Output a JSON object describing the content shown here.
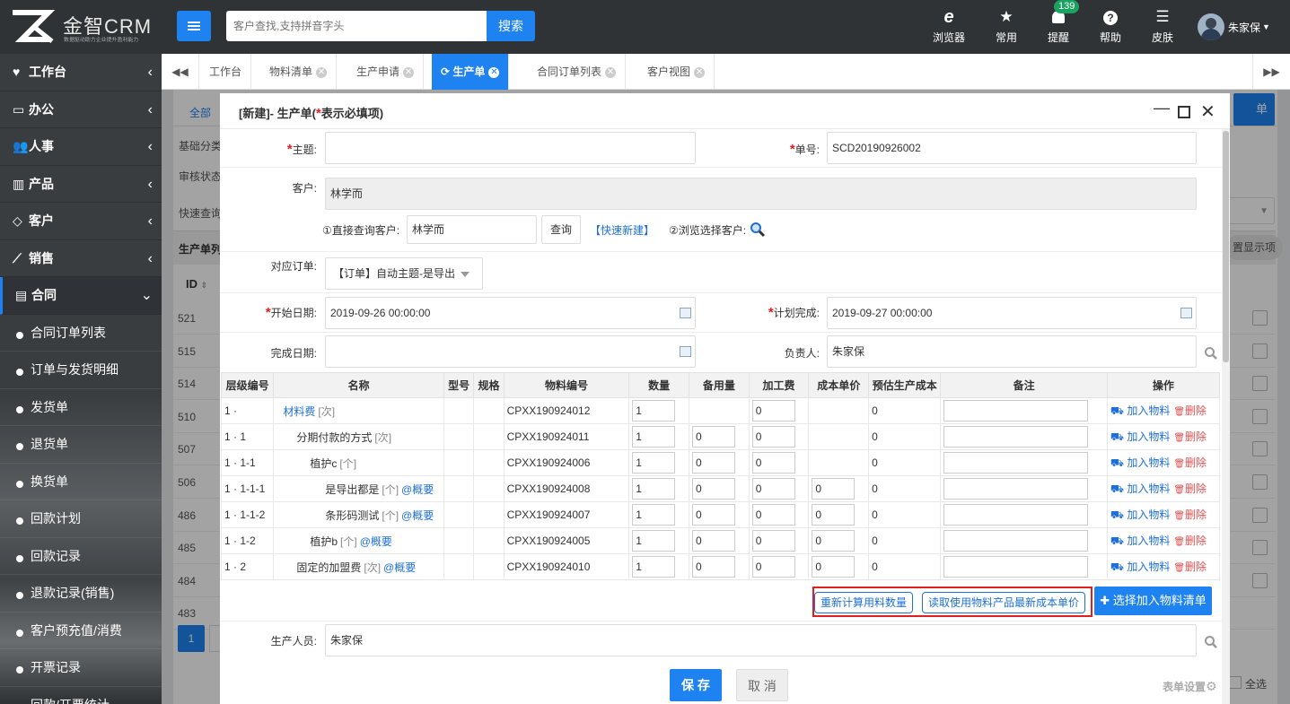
{
  "app": {
    "brand": "金智CRM",
    "slogan": "数据驱动助力企业提升盈利能力"
  },
  "header": {
    "search_placeholder": "客户查找,支持拼音字头",
    "search_button": "搜索",
    "tools": [
      {
        "label": "浏览器",
        "icon": "ie-icon"
      },
      {
        "label": "常用",
        "icon": "star-icon"
      },
      {
        "label": "提醒",
        "icon": "bell-icon",
        "badge": "139"
      },
      {
        "label": "帮助",
        "icon": "help-icon"
      },
      {
        "label": "皮肤",
        "icon": "skin-icon"
      }
    ],
    "user": "朱家保"
  },
  "sidebar": {
    "items": [
      {
        "label": "工作台",
        "icon": "heart-icon"
      },
      {
        "label": "办公",
        "icon": "laptop-icon"
      },
      {
        "label": "人事",
        "icon": "users-icon"
      },
      {
        "label": "产品",
        "icon": "barcode-icon"
      },
      {
        "label": "客户",
        "icon": "diamond-icon"
      },
      {
        "label": "销售",
        "icon": "chart-icon"
      },
      {
        "label": "合同",
        "icon": "contract-icon"
      }
    ],
    "sub_items": [
      "合同订单列表",
      "订单与发货明细",
      "发货单",
      "退货单",
      "换货单",
      "回款计划",
      "回款记录",
      "退款记录(销售)",
      "客户预充值/消费",
      "开票记录",
      "回款/开票统计"
    ]
  },
  "tabs": [
    {
      "label": "工作台",
      "closable": false
    },
    {
      "label": "物料清单",
      "closable": true
    },
    {
      "label": "生产申请",
      "closable": true
    },
    {
      "label": "生产单",
      "closable": true,
      "active": true
    },
    {
      "label": "合同订单列表",
      "closable": true
    },
    {
      "label": "客户视图",
      "closable": true
    }
  ],
  "background": {
    "tab_all": "全部",
    "filter_basic": "基础分类",
    "filter_audit": "审核状态",
    "quick_search": "快速查询",
    "list_title": "生产单列",
    "id_header": "ID",
    "display_items": "置显示项",
    "right_btn": "单",
    "ids": [
      "521",
      "515",
      "514",
      "510",
      "507",
      "506",
      "486",
      "485",
      "484",
      "483"
    ],
    "page": "1",
    "select_all": "全选",
    "form_settings": "表单设置"
  },
  "modal": {
    "title_prefix": "[新建]- 生产单(",
    "title_star": "*",
    "title_suffix": "表示必填项)",
    "subject_label": "主题:",
    "number_label": "单号:",
    "number_value": "SCD20190926002",
    "customer_label": "客户:",
    "customer_value": "林学而",
    "direct_query_label": "①直接查询客户:",
    "direct_query_value": "林学而",
    "query_button": "查询",
    "quick_new_link": "【快速新建】",
    "browse_label": "②浏览选择客户:",
    "order_label": "对应订单:",
    "order_value": "【订单】自动主题-是导出",
    "start_label": "开始日期:",
    "start_value": "2019-09-26 00:00:00",
    "plan_label": "计划完成:",
    "plan_value": "2019-09-27 00:00:00",
    "finish_label": "完成日期:",
    "owner_label": "负责人:",
    "owner_value": "朱家保",
    "producer_label": "生产人员:",
    "producer_value": "朱家保",
    "recalc_button": "重新计算用料数量",
    "read_cost_button": "读取使用物料产品最新成本单价",
    "select_bom_button": "✚ 选择加入物料清单",
    "save_button": "保 存",
    "cancel_button": "取 消"
  },
  "bom": {
    "headers": [
      "层级编号",
      "名称",
      "型号",
      "规格",
      "物料编号",
      "数量",
      "备用量",
      "加工费",
      "成本单价",
      "预估生产成本",
      "备注",
      "操作"
    ],
    "add_label": "加入物料",
    "del_label": "删除",
    "summary_label": "概要",
    "rows": [
      {
        "level": "1 ·",
        "name": "材料费",
        "unit": "[次]",
        "code": "CPXX190924012",
        "qty": "1",
        "spare": "",
        "fee": "0",
        "cost": "",
        "est": "0",
        "summary": false,
        "indent": 60,
        "link": true
      },
      {
        "level": "1 · 1",
        "name": "分期付款的方式",
        "unit": "[次]",
        "code": "CPXX190924011",
        "qty": "1",
        "spare": "0",
        "fee": "0",
        "cost": "",
        "est": "0",
        "summary": false,
        "indent": 75,
        "link": false
      },
      {
        "level": "1 · 1-1",
        "name": "植护c",
        "unit": "[个]",
        "code": "CPXX190924006",
        "qty": "1",
        "spare": "0",
        "fee": "0",
        "cost": "",
        "est": "0",
        "summary": false,
        "indent": 90,
        "link": false
      },
      {
        "level": "1 · 1-1-1",
        "name": "是导出都是",
        "unit": "[个]",
        "code": "CPXX190924008",
        "qty": "1",
        "spare": "0",
        "fee": "0",
        "cost": "0",
        "est": "0",
        "summary": true,
        "indent": 107,
        "link": false
      },
      {
        "level": "1 · 1-1-2",
        "name": "条形码测试",
        "unit": "[个]",
        "code": "CPXX190924007",
        "qty": "1",
        "spare": "0",
        "fee": "0",
        "cost": "0",
        "est": "0",
        "summary": true,
        "indent": 107,
        "link": false
      },
      {
        "level": "1 · 1-2",
        "name": "植护b",
        "unit": "[个]",
        "code": "CPXX190924005",
        "qty": "1",
        "spare": "0",
        "fee": "0",
        "cost": "0",
        "est": "0",
        "summary": true,
        "indent": 90,
        "link": false
      },
      {
        "level": "1 · 2",
        "name": "固定的加盟费",
        "unit": "[次]",
        "code": "CPXX190924010",
        "qty": "1",
        "spare": "0",
        "fee": "0",
        "cost": "0",
        "est": "0",
        "summary": true,
        "indent": 75,
        "link": false
      }
    ]
  }
}
